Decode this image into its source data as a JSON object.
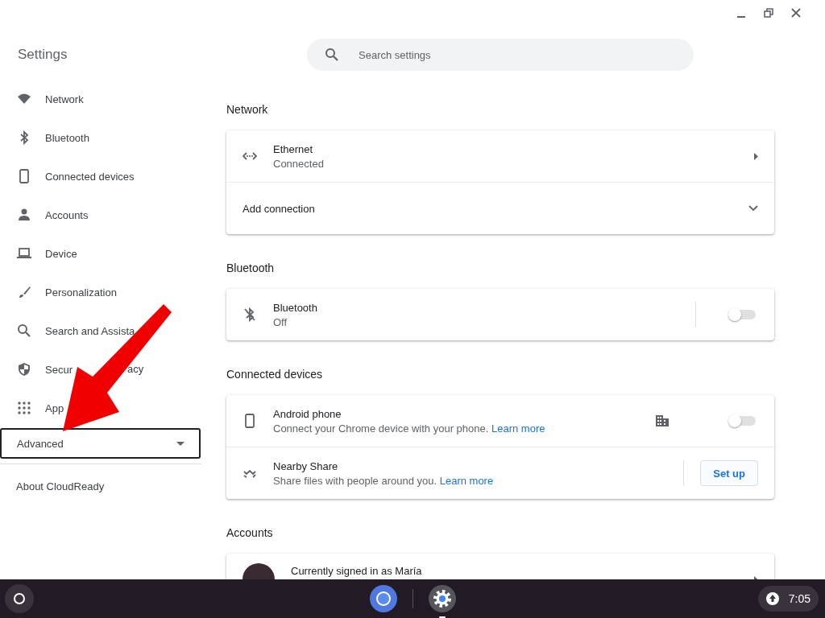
{
  "sidebar": {
    "title": "Settings",
    "items": [
      {
        "kind": "wifi",
        "label": "Network"
      },
      {
        "kind": "bluetooth",
        "label": "Bluetooth"
      },
      {
        "kind": "phone",
        "label": "Connected devices"
      },
      {
        "kind": "person",
        "label": "Accounts"
      },
      {
        "kind": "laptop",
        "label": "Device"
      },
      {
        "kind": "brush",
        "label": "Personalization"
      },
      {
        "kind": "search",
        "label": "Search and Assista"
      },
      {
        "kind": "shield",
        "label": "Secur",
        "label_tail": "acy"
      },
      {
        "kind": "grid",
        "label": "App"
      }
    ],
    "advanced": {
      "label": "Advanced",
      "focused": true,
      "expanded": false
    },
    "about": {
      "label": "About CloudReady"
    }
  },
  "search": {
    "placeholder": "Search settings"
  },
  "sections": [
    {
      "title": "Network",
      "rows": [
        {
          "kind": "link",
          "title": "Ethernet",
          "subtitle": "Connected"
        },
        {
          "kind": "expand",
          "title": "Add connection",
          "expanded": false
        }
      ]
    },
    {
      "title": "Bluetooth",
      "rows": [
        {
          "kind": "toggle",
          "title": "Bluetooth",
          "subtitle": "Off",
          "on": false
        }
      ]
    },
    {
      "title": "Connected devices",
      "rows": [
        {
          "kind": "toggle",
          "title": "Android phone",
          "subtitle": "Connect your Chrome device with your phone.",
          "link": "Learn more",
          "badge": true,
          "on": false
        },
        {
          "kind": "button",
          "title": "Nearby Share",
          "subtitle": "Share files with people around you.",
          "link": "Learn more",
          "button": "Set up"
        }
      ]
    },
    {
      "title": "Accounts",
      "rows": [
        {
          "kind": "account",
          "title": "Currently signed in as María"
        }
      ]
    }
  ],
  "shelf": {
    "apps": [
      {
        "kind": "chrome",
        "active": false
      },
      {
        "kind": "settings",
        "active": true
      }
    ],
    "time": "7:05"
  }
}
